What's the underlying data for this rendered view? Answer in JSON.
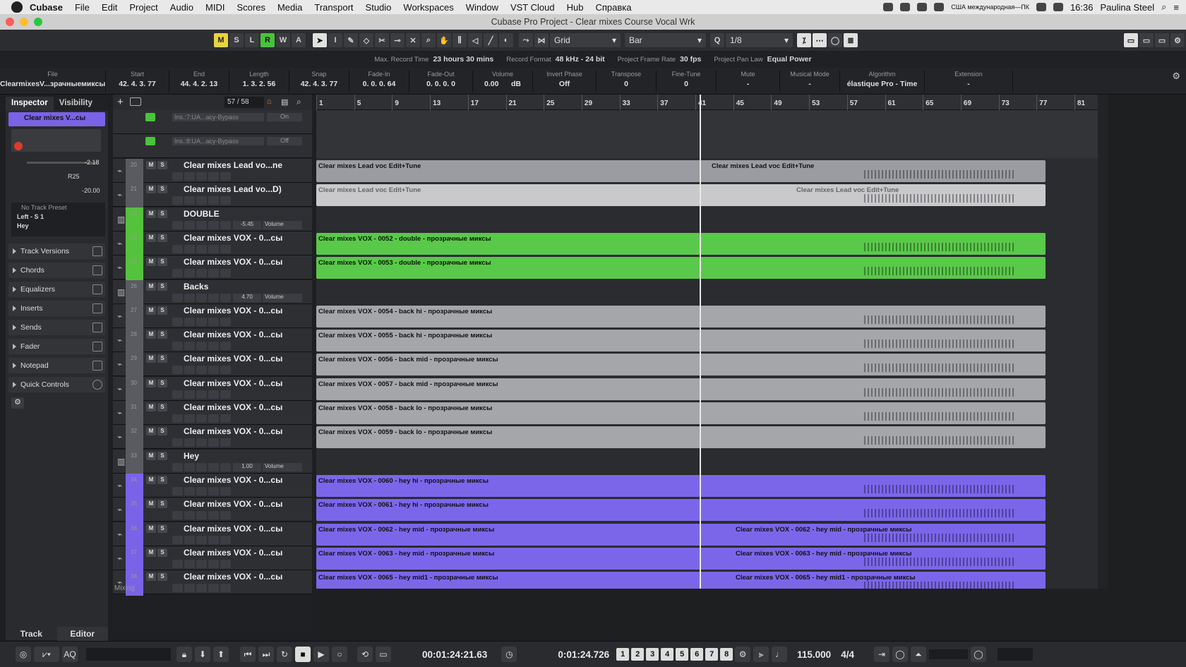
{
  "menubar": {
    "app": "Cubase",
    "items": [
      "File",
      "Edit",
      "Project",
      "Audio",
      "MIDI",
      "Scores",
      "Media",
      "Transport",
      "Studio",
      "Workspaces",
      "Window",
      "VST Cloud",
      "Hub",
      "Справка"
    ],
    "keyboard": "США международная—ПК",
    "time": "16:36",
    "user": "Paulina Steel"
  },
  "window": {
    "title": "Cubase Pro Project - Clear mixes Course Vocal Wrk"
  },
  "toolbar": {
    "buttons": [
      "M",
      "S",
      "L",
      "R",
      "W",
      "A"
    ],
    "grid_label": "Grid",
    "bar_label": "Bar",
    "quantize": "1/8"
  },
  "status": {
    "max_record_label": "Max. Record Time",
    "max_record": "23 hours 30 mins",
    "format_label": "Record Format",
    "format": "48 kHz - 24 bit",
    "framerate_label": "Project Frame Rate",
    "framerate": "30 fps",
    "panlaw_label": "Project Pan Law",
    "panlaw": "Equal Power"
  },
  "info": {
    "file_h": "File",
    "file_v": "ClearmixesV...зрачныемиксы",
    "start_h": "Start",
    "start_v": "42. 4. 3. 77",
    "end_h": "End",
    "end_v": "44. 4. 2. 13",
    "length_h": "Length",
    "length_v": "1. 3. 2. 56",
    "snap_h": "Snap",
    "snap_v": "42. 4. 3. 77",
    "fadein_h": "Fade-In",
    "fadein_v": "0. 0. 0. 64",
    "fadeout_h": "Fade-Out",
    "fadeout_v": "0. 0. 0.  0",
    "volume_h": "Volume",
    "volume_v": "0.00",
    "volume_u": "dB",
    "invert_h": "Invert Phase",
    "invert_v": "Off",
    "transpose_h": "Transpose",
    "transpose_v": "0",
    "finetune_h": "Fine-Tune",
    "finetune_v": "0",
    "mute_h": "Mute",
    "mute_v": "-",
    "musical_h": "Musical Mode",
    "musical_v": "-",
    "algo_h": "Algorithm",
    "algo_v": "élastique Pro - Time",
    "ext_h": "Extension",
    "ext_v": "-"
  },
  "inspector": {
    "tab_inspector": "Inspector",
    "tab_visibility": "Visibility",
    "track_name": "Clear mixes V...сы",
    "vol_value": "-2.18",
    "pan_value": "R25",
    "vol2_value": "-20.00",
    "preset": "No Track Preset",
    "routing1": "Left - S 1",
    "routing2": "Hey",
    "sections": [
      "Track Versions",
      "Chords",
      "Equalizers",
      "Inserts",
      "Sends",
      "Fader",
      "Notepad",
      "Quick Controls"
    ],
    "bottom_tabs": [
      "Track",
      "Editor"
    ]
  },
  "tracklist": {
    "counter": "57 / 58",
    "mixing": "Mixing",
    "inserts": [
      {
        "name": "Ins.:7:UA...acy-Bypass",
        "state": "On"
      },
      {
        "name": "Ins.:8:UA...acy-Bypass",
        "state": "Off"
      }
    ],
    "tracks": [
      {
        "num": "20",
        "name": "Clear mixes Lead vo...ne",
        "color": "#5a5b60",
        "folder": false
      },
      {
        "num": "21",
        "name": "Clear mixes Lead vo...D)",
        "color": "#5a5b60",
        "folder": false
      },
      {
        "num": "23",
        "name": "DOUBLE",
        "color": "#55c23d",
        "folder": true,
        "vol": "-5.45",
        "vol_label": "Volume"
      },
      {
        "num": "24",
        "name": "Clear mixes VOX - 0...сы",
        "color": "#55c23d",
        "folder": false
      },
      {
        "num": "25",
        "name": "Clear mixes VOX - 0...сы",
        "color": "#55c23d",
        "folder": false
      },
      {
        "num": "26",
        "name": "Backs",
        "color": "#5a5b60",
        "folder": true,
        "vol": "4.70",
        "vol_label": "Volume"
      },
      {
        "num": "27",
        "name": "Clear mixes VOX - 0...сы",
        "color": "#5a5b60",
        "folder": false
      },
      {
        "num": "28",
        "name": "Clear mixes VOX - 0...сы",
        "color": "#5a5b60",
        "folder": false
      },
      {
        "num": "29",
        "name": "Clear mixes VOX - 0...сы",
        "color": "#5a5b60",
        "folder": false
      },
      {
        "num": "30",
        "name": "Clear mixes VOX - 0...сы",
        "color": "#5a5b60",
        "folder": false
      },
      {
        "num": "31",
        "name": "Clear mixes VOX - 0...сы",
        "color": "#5a5b60",
        "folder": false
      },
      {
        "num": "32",
        "name": "Clear mixes VOX - 0...сы",
        "color": "#5a5b60",
        "folder": false
      },
      {
        "num": "33",
        "name": "Hey",
        "color": "#5a5b60",
        "folder": true,
        "vol": "1.00",
        "vol_label": "Volume"
      },
      {
        "num": "34",
        "name": "Clear mixes VOX - 0...сы",
        "color": "#7a63e6",
        "folder": false
      },
      {
        "num": "35",
        "name": "Clear mixes VOX - 0...сы",
        "color": "#7a63e6",
        "folder": false
      },
      {
        "num": "36",
        "name": "Clear mixes VOX - 0...сы",
        "color": "#7a63e6",
        "folder": false
      },
      {
        "num": "37",
        "name": "Clear mixes VOX - 0...сы",
        "color": "#7a63e6",
        "folder": false
      },
      {
        "num": "38",
        "name": "Clear mixes VOX - 0...сы",
        "color": "#7a63e6",
        "folder": false
      }
    ]
  },
  "ruler": [
    "1",
    "5",
    "9",
    "13",
    "17",
    "21",
    "25",
    "29",
    "33",
    "37",
    "41",
    "45",
    "49",
    "53",
    "57",
    "61",
    "65",
    "69",
    "73",
    "77",
    "81"
  ],
  "clips": [
    {
      "lane": 0,
      "label": "Clear mixes Lead voc Edit+Tune",
      "color": "#9b9ca1",
      "text": "#111",
      "end": "Clear mixes Lead voc Edit+Tune"
    },
    {
      "lane": 1,
      "label": "Clear mixes Lead voc Edit+Tune",
      "color": "#c9c9cc",
      "text": "#666",
      "end": "Clear mixes Lead voc Edit+Tune"
    },
    {
      "lane": 3,
      "label": "Clear mixes VOX - 0052 - double - прозрачные миксы",
      "color": "#5ac84a",
      "text": "#111"
    },
    {
      "lane": 4,
      "label": "Clear mixes VOX - 0053 - double - прозрачные миксы",
      "color": "#5ac84a",
      "text": "#111"
    },
    {
      "lane": 6,
      "label": "Clear mixes VOX - 0054 - back hi - прозрачные миксы",
      "color": "#a5a6aa",
      "text": "#111"
    },
    {
      "lane": 7,
      "label": "Clear mixes VOX - 0055 - back hi - прозрачные миксы",
      "color": "#a5a6aa",
      "text": "#111"
    },
    {
      "lane": 8,
      "label": "Clear mixes VOX - 0056 - back mid - прозрачные миксы",
      "color": "#a5a6aa",
      "text": "#111"
    },
    {
      "lane": 9,
      "label": "Clear mixes VOX - 0057 - back mid - прозрачные миксы",
      "color": "#a5a6aa",
      "text": "#111"
    },
    {
      "lane": 10,
      "label": "Clear mixes VOX - 0058 - back lo - прозрачные миксы",
      "color": "#a5a6aa",
      "text": "#111"
    },
    {
      "lane": 11,
      "label": "Clear mixes VOX - 0059 - back lo - прозрачные миксы",
      "color": "#a5a6aa",
      "text": "#111"
    },
    {
      "lane": 13,
      "label": "Clear mixes VOX - 0060 - hey hi - прозрачные миксы",
      "color": "#7b66ea",
      "text": "#111"
    },
    {
      "lane": 14,
      "label": "Clear mixes VOX - 0061 - hey hi - прозрачные миксы",
      "color": "#7b66ea",
      "text": "#111"
    },
    {
      "lane": 15,
      "label": "Clear mixes VOX - 0062 - hey mid - прозрачные миксы",
      "color": "#7b66ea",
      "text": "#111",
      "end": "Clear mixes VOX - 0062 - hey mid - прозрачные миксы"
    },
    {
      "lane": 16,
      "label": "Clear mixes VOX - 0063 - hey mid - прозрачные миксы",
      "color": "#7b66ea",
      "text": "#111",
      "end": "Clear mixes VOX - 0063 - hey mid - прозрачные миксы"
    },
    {
      "lane": 17,
      "label": "Clear mixes VOX - 0065 - hey mid1 - прозрачные миксы",
      "color": "#7b66ea",
      "text": "#111",
      "end": "Clear mixes VOX - 0065 - hey mid1 - прозрачные миксы"
    }
  ],
  "transport": {
    "aq": "AQ",
    "primary_time": "00:01:24:21.63",
    "secondary_time": "0:01:24.726",
    "markers": [
      "1",
      "2",
      "3",
      "4",
      "5",
      "6",
      "7",
      "8"
    ],
    "tempo": "115.000",
    "signature": "4/4"
  }
}
